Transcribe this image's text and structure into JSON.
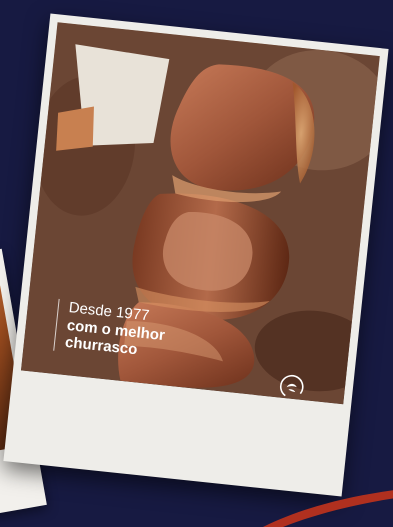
{
  "overlay": {
    "since": "Desde 1977",
    "slogan_line1": "com o melhor",
    "slogan_line2": "churrasco"
  },
  "colors": {
    "background": "#171a42",
    "card": "#eeede9",
    "accent_red": "#b0301f"
  },
  "icons": {
    "brand_logo": "brand-logo-icon"
  }
}
